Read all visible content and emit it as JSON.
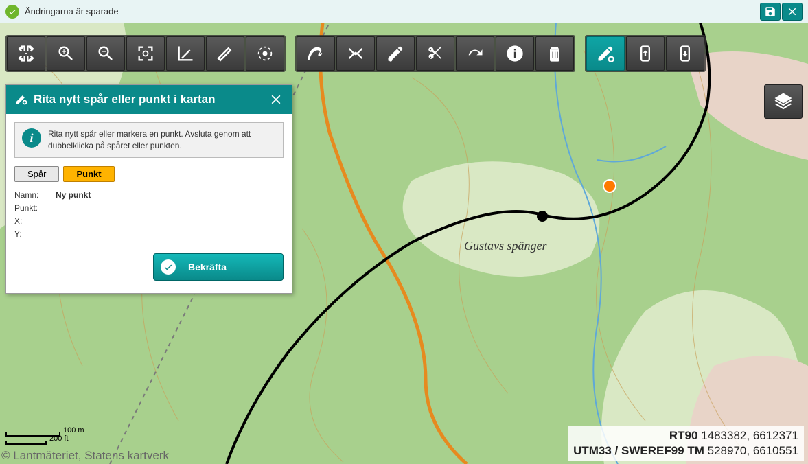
{
  "status": {
    "message": "Ändringarna är sparade"
  },
  "dialog": {
    "title": "Rita nytt spår eller punkt i kartan",
    "info": "Rita nytt spår eller markera en punkt. Avsluta genom att dubbelklicka på spåret eller punkten.",
    "tabs": {
      "track": "Spår",
      "point": "Punkt"
    },
    "form": {
      "name_label": "Namn:",
      "name_value": "Ny punkt",
      "point_label": "Punkt:",
      "x_label": "X:",
      "y_label": "Y:"
    },
    "confirm": "Bekräfta"
  },
  "map": {
    "place_label": "Gustavs spänger",
    "scale": {
      "metric": "100 m",
      "imperial": "200 ft"
    },
    "attribution": "© Lantmäteriet, Statens kartverk",
    "coords": {
      "rt90_label": "RT90",
      "rt90_val": "1483382, 6612371",
      "utm_label": "UTM33 / SWEREF99 TM",
      "utm_val": "528970, 6610551"
    }
  }
}
